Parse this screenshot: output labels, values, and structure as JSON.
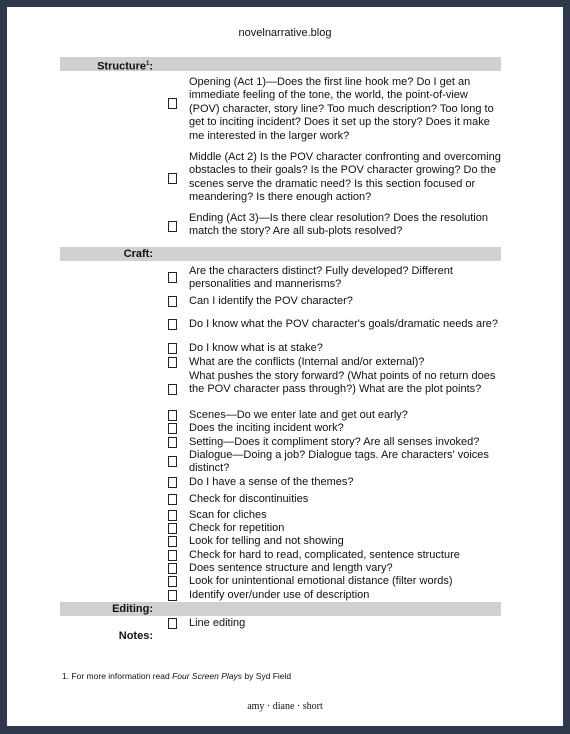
{
  "header": {
    "title": "novelnarrative.blog"
  },
  "sections": {
    "structure": {
      "label": "Structure",
      "footnote_mark": "1",
      "suffix": ":",
      "items": [
        "Opening (Act 1)—Does the first line hook me? Do I get an immediate feeling of the tone, the world, the point-of-view (POV) character, story line? Too much description? Too long to get to inciting incident?  Does it set up the story?  Does it make me interested in the  larger work?",
        "Middle (Act 2) Is the POV character confronting and overcoming obstacles to their goals?  Is the POV character growing?  Do the scenes serve the dramatic need?  Is this section focused or meandering?  Is there enough action?",
        "Ending (Act 3)—Is there clear resolution? Does the resolution match the story? Are all sub-plots resolved?"
      ]
    },
    "craft": {
      "label": "Craft:",
      "items": [
        "Are the characters distinct? Fully developed? Different personalities and mannerisms?",
        "Can I identify the POV character?",
        "Do I know what the POV character's goals/dramatic needs are?",
        "Do I know what is at stake?",
        "What are the conflicts (Internal and/or external)?",
        "What pushes the story forward? (What points of no return does the POV character pass through?) What are the plot points?",
        "Scenes—Do we enter late and get out early?",
        "Does the inciting incident work?",
        "Setting—Does it compliment story?  Are all senses invoked?",
        "Dialogue—Doing a job?  Dialogue tags.  Are characters' voices distinct?",
        "Do I have a sense of the themes?",
        "Check for discontinuities",
        "Scan for cliches",
        "Check for repetition",
        "Look for telling and not showing",
        "Check for hard to read, complicated, sentence structure",
        "Does sentence structure and length vary?",
        "Look for unintentional emotional distance (filter words)",
        "Identify over/under use of description"
      ]
    },
    "editing": {
      "label": "Editing:",
      "items": [
        "Line editing"
      ]
    },
    "notes": {
      "label": "Notes:"
    }
  },
  "footnote": {
    "prefix": "1. For more information read ",
    "book": "Four Screen Plays",
    "suffix": "  by Syd Field"
  },
  "signature": "amy · diane · short"
}
